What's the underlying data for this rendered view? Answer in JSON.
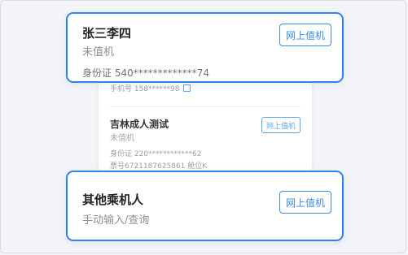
{
  "bg_list": {
    "row1_phone": "手机号 158******98",
    "row2": {
      "name": "吉林成人测试",
      "status": "未值机",
      "id_line": "身份证 220************62",
      "ticket_line": "票号6721187625861 舱位K",
      "button": "网上值机"
    }
  },
  "card1": {
    "name": "张三李四",
    "status": "未值机",
    "id_line": "身份证 540*************74",
    "button": "网上值机"
  },
  "card2": {
    "name": "其他乘机人",
    "subtitle": "手动输入/查询",
    "button": "网上值机"
  },
  "colors": {
    "accent": "#2f82e8",
    "button_text": "#3b8ee6"
  }
}
